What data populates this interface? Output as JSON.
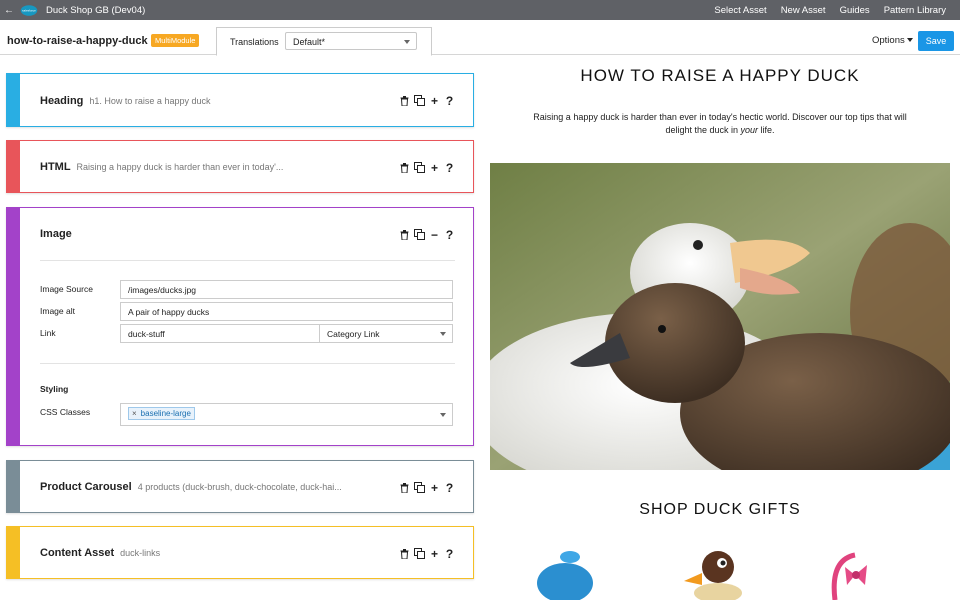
{
  "topbar": {
    "title": "Duck Shop GB (Dev04)",
    "nav": [
      "Select Asset",
      "New Asset",
      "Guides",
      "Pattern Library"
    ]
  },
  "subbar": {
    "slug": "how-to-raise-a-happy-duck",
    "badge": "MultiModule",
    "translations_label": "Translations",
    "translations_value": "Default*",
    "options_label": "Options",
    "save_label": "Save"
  },
  "modules": {
    "heading": {
      "title": "Heading",
      "summary": "h1. How to raise a happy duck",
      "color": "#29aee3"
    },
    "html": {
      "title": "HTML",
      "summary": "Raising a happy duck is harder than ever in today'...",
      "color": "#e8555a"
    },
    "image": {
      "title": "Image",
      "color": "#a342c9",
      "source_label": "Image Source",
      "source_value": "/images/ducks.jpg",
      "alt_label": "Image alt",
      "alt_value": "A pair of happy ducks",
      "link_label": "Link",
      "link_value": "duck-stuff",
      "link_type": "Category Link",
      "styling_heading": "Styling",
      "css_label": "CSS Classes",
      "css_tag": "baseline-large"
    },
    "carousel": {
      "title": "Product Carousel",
      "summary": "4 products (duck-brush, duck-chocolate, duck-hai...",
      "color": "#7a8d97"
    },
    "content": {
      "title": "Content Asset",
      "summary": "duck-links",
      "color": "#f5bf25"
    }
  },
  "preview": {
    "title": "HOW TO RAISE A HAPPY DUCK",
    "intro_before": "Raising a happy duck is harder than ever in today's hectic world. Discover our top tips that will delight the duck in ",
    "intro_em": "your",
    "intro_after": " life.",
    "shop_heading": "SHOP DUCK GIFTS"
  }
}
